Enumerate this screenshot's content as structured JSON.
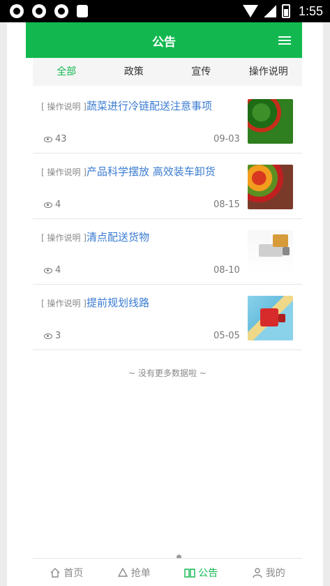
{
  "status_bar": {
    "time": "1:55"
  },
  "header": {
    "title": "公告",
    "menu_icon": "menu-icon"
  },
  "tabs": [
    {
      "label": "全部",
      "active": true
    },
    {
      "label": "政策",
      "active": false
    },
    {
      "label": "宣传",
      "active": false
    },
    {
      "label": "操作说明",
      "active": false
    }
  ],
  "items": [
    {
      "tag": "[ 操作说明 ]",
      "title": "蔬菜进行冷链配送注意事项",
      "views": "43",
      "date": "09-03",
      "image": "vegetables"
    },
    {
      "tag": "[ 操作说明 ]",
      "title": "产品科学摆放 高效装车卸货",
      "views": "4",
      "date": "08-15",
      "image": "fruit"
    },
    {
      "tag": "[ 操作说明 ]",
      "title": "清点配送货物",
      "views": "4",
      "date": "08-10",
      "image": "truck-crates"
    },
    {
      "tag": "[ 操作说明 ]",
      "title": "提前规划线路",
      "views": "3",
      "date": "05-05",
      "image": "map-truck"
    }
  ],
  "list_end_text": "~ 没有更多数据啦 ~",
  "bottom_nav": [
    {
      "label": "首页",
      "icon": "home-icon",
      "active": false
    },
    {
      "label": "抢单",
      "icon": "recycle-icon",
      "active": false
    },
    {
      "label": "公告",
      "icon": "book-icon",
      "active": true
    },
    {
      "label": "我的",
      "icon": "user-icon",
      "active": false
    }
  ],
  "colors": {
    "accent": "#12b84f",
    "title_link": "#3a7bd0"
  }
}
